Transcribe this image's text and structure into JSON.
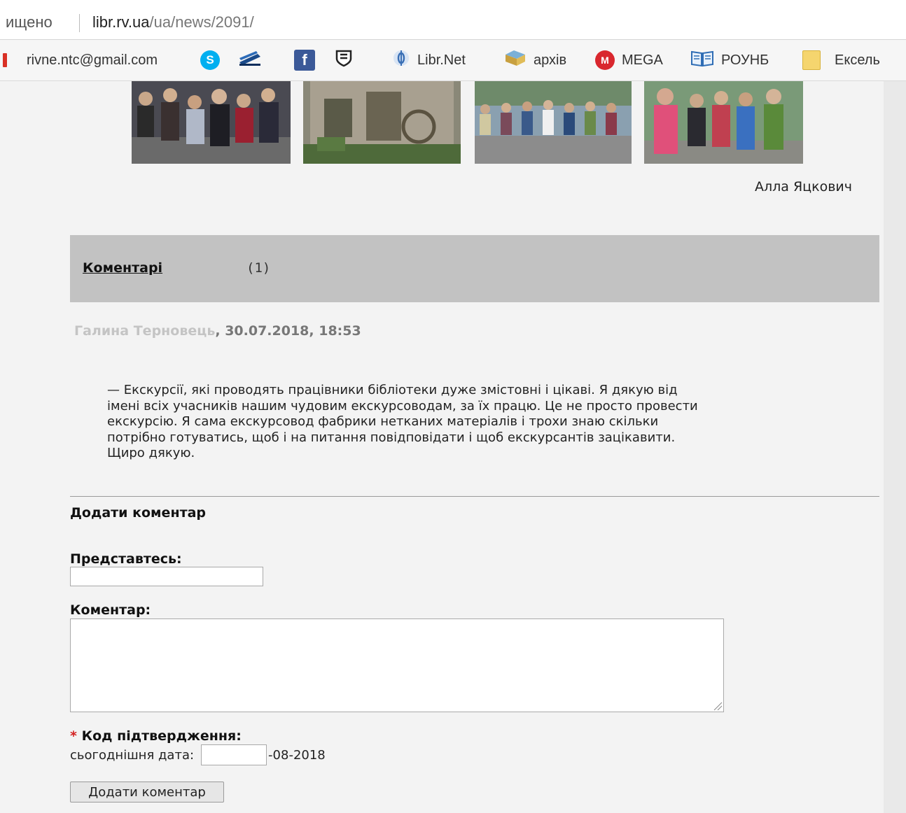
{
  "browser": {
    "secure_text": "ищено",
    "url_domain": "libr.rv.ua",
    "url_path": "/ua/news/2091/",
    "bookmarks": [
      {
        "icon": "gmail-icon",
        "label": "rivne.ntc@gmail.com"
      },
      {
        "icon": "skype-icon",
        "label": ""
      },
      {
        "icon": "book-stack-icon",
        "label": ""
      },
      {
        "icon": "facebook-icon",
        "label": ""
      },
      {
        "icon": "shield-icon",
        "label": ""
      },
      {
        "icon": "libr-net-icon",
        "label": "Libr.Net"
      },
      {
        "icon": "archive-icon",
        "label": "архів"
      },
      {
        "icon": "mega-icon",
        "label": "MEGA"
      },
      {
        "icon": "open-book-icon",
        "label": "РОУНБ"
      },
      {
        "icon": "folder-icon",
        "label": "Ексель"
      }
    ]
  },
  "article": {
    "author": "Алла Яцкович"
  },
  "comments": {
    "link_label": "Коментарі",
    "count": "(1)",
    "items": [
      {
        "name": "Галина Терновець",
        "datetime": ", 30.07.2018, 18:53",
        "lines": [
          "— Екскурсії, які проводять працівники бібліотеки дуже змістовні і цікаві. Я дякую від",
          "імені всіх учасників нашим чудовим екскурсоводам, за їх працю. Це не просто провести",
          "екскурсію. Я сама екскурсовод фабрики нетканих матеріалів і трохи знаю скільки",
          "потрібно готуватись, щоб і на питання повідповідати і щоб екскурсантів зацікавити.",
          "Щиро дякую."
        ]
      }
    ]
  },
  "form": {
    "title": "Додати коментар",
    "name_label": "Представтесь:",
    "name_value": "",
    "comment_label": "Коментар:",
    "comment_value": "",
    "captcha_star": "*",
    "captcha_label": "Код підтвердження:",
    "date_prefix": "сьогоднішня дата:",
    "date_value": "",
    "date_suffix": "-08-2018",
    "submit_label": "Додати коментар"
  },
  "colors": {
    "comments_bar": "#c2c2c2",
    "commenter_name": "#c4c4c4",
    "required_star": "#d32020"
  }
}
